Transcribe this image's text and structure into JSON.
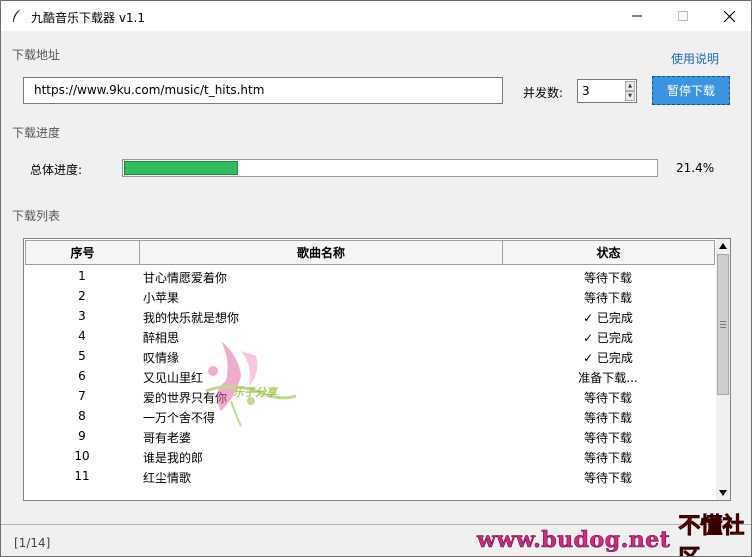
{
  "window": {
    "title": "九酷音乐下载器 v1.1"
  },
  "sections": {
    "download_address": "下载地址",
    "download_progress": "下载进度",
    "download_list": "下载列表"
  },
  "help": {
    "label": "使用说明"
  },
  "url_input": {
    "value": "https://www.9ku.com/music/t_hits.htm"
  },
  "concurrency": {
    "label": "并发数:",
    "value": "3"
  },
  "pause_button": {
    "label": "暂停下载"
  },
  "progress": {
    "label": "总体进度:",
    "percent_text": "21.4%",
    "fraction": 0.214
  },
  "table": {
    "columns": {
      "no": "序号",
      "name": "歌曲名称",
      "status": "状态"
    },
    "rows": [
      {
        "no": "1",
        "name": "甘心情愿爱着你",
        "status": "等待下载"
      },
      {
        "no": "2",
        "name": "小苹果",
        "status": "等待下载"
      },
      {
        "no": "3",
        "name": "我的快乐就是想你",
        "status": "✓ 已完成"
      },
      {
        "no": "4",
        "name": "醉相思",
        "status": "✓ 已完成"
      },
      {
        "no": "5",
        "name": "叹情缘",
        "status": "✓ 已完成"
      },
      {
        "no": "6",
        "name": "又见山里红",
        "status": "准备下载..."
      },
      {
        "no": "7",
        "name": "爱的世界只有你",
        "status": "等待下载"
      },
      {
        "no": "8",
        "name": "一万个舍不得",
        "status": "等待下载"
      },
      {
        "no": "9",
        "name": "哥有老婆",
        "status": "等待下载"
      },
      {
        "no": "10",
        "name": "谁是我的郎",
        "status": "等待下载"
      },
      {
        "no": "11",
        "name": "红尘情歌",
        "status": "等待下载"
      }
    ]
  },
  "statusbar": {
    "text": "[1/14]"
  },
  "watermarks": {
    "center": "乐子分享",
    "corner_url": "www.budog.net",
    "corner_name": "不懂社区"
  },
  "colors": {
    "accent": "#3c93e0",
    "progress": "#2ebd59",
    "link": "#1a6dc2"
  }
}
